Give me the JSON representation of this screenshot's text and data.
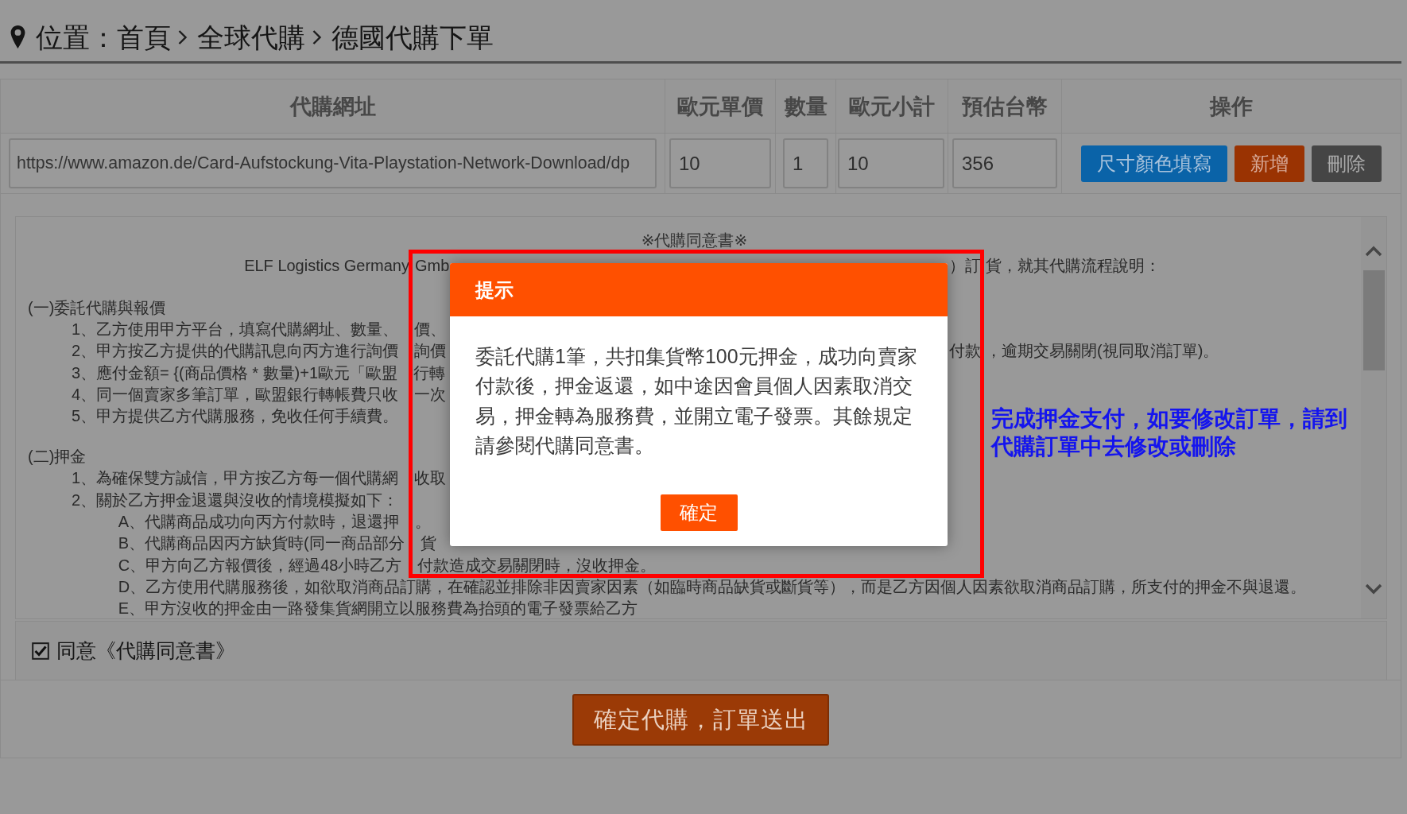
{
  "breadcrumb": {
    "label": "位置：",
    "items": [
      "首頁",
      "全球代購",
      "德國代購下單"
    ]
  },
  "order_table": {
    "columns": [
      "代購網址",
      "歐元單價",
      "數量",
      "歐元小計",
      "預估台幣",
      "操作"
    ],
    "row": {
      "url": "https://www.amazon.de/Card-Aufstockung-Vita-Playstation-Network-Download/dp",
      "unit_price": "10",
      "quantity": "1",
      "subtotal": "10",
      "estimated_twd": "356",
      "actions": [
        {
          "label": "尺寸顏色填寫",
          "kind": "edit"
        },
        {
          "label": "新增",
          "kind": "add"
        },
        {
          "label": "刪除",
          "kind": "delete"
        }
      ]
    }
  },
  "agreement": {
    "title": "※代購同意書※",
    "intro": {
      "text": "ELF Logistics Germany",
      "text_inside_frame": "Gmb",
      "text_right_of_dialog": "）訂",
      "text_after_frame": "貨，就其代購流程說明："
    },
    "sections": [
      {
        "heading": "(一)委託代購與報價",
        "items": [
          {
            "text": "1、乙方使用甲方平台，填寫代購網址、數量、",
            "text_inside_frame": "價、"
          },
          {
            "text": "2、甲方按乙方提供的代購訊息向丙方進行詢價",
            "text_inside_frame": "詢價",
            "text_right_of_dialog": "付款",
            "text_after_frame": "，逾期交易關閉(視同取消訂單)。"
          },
          {
            "text": "3、應付金額= {(商品價格 * 數量)+1歐元「歐盟",
            "text_inside_frame": "行轉"
          },
          {
            "text": "4、同一個賣家多筆訂單，歐盟銀行轉帳費只收",
            "text_inside_frame": "一次"
          },
          {
            "text": "5、甲方提供乙方代購服務，免收任何手續費。"
          }
        ]
      },
      {
        "heading": "(二)押金",
        "items": [
          {
            "text": "1、為確保雙方誠信，甲方按乙方每一個代購網",
            "text_inside_frame": "收取"
          },
          {
            "text": "2、關於乙方押金退還與沒收的情境模擬如下：",
            "children": [
              {
                "text": "A、代購商品成功向丙方付款時，退還押",
                "text_inside_frame": "。"
              },
              {
                "text": "B、代購商品因丙方缺貨時(同一商品部分",
                "text_inside_frame": "貨"
              },
              {
                "text": "C、甲方向乙方報價後，經過48小時乙方",
                "text_inside_frame": "付款造成交易關閉時，沒收押金。"
              },
              {
                "text": "D、乙方使用代購服務後，如欲取消商品訂購，在確認並排除非因賣家因素（如臨時商品缺貨或斷貨等），而是乙方因個人因素欲取消商品訂購，所支付的押金不與退還。"
              },
              {
                "text": "E、甲方沒收的押金由一路發集貨網開立以服務費為抬頭的電子發票給乙方"
              }
            ]
          }
        ]
      }
    ]
  },
  "agree_checkbox": {
    "label": "同意《代購同意書》",
    "checked": true
  },
  "submit_button": "確定代購，訂單送出",
  "note": "完成押金支付，如要修改訂單，請到代購訂單中去修改或刪除",
  "dialog": {
    "title": "提示",
    "message": "委託代購1筆，共扣集貨幣100元押金，成功向賣家付款後，押金返還，如中途因會員個人因素取消交易，押金轉為服務費，並開立電子發票。其餘規定請參閱代購同意書。",
    "confirm_button": "確定"
  }
}
